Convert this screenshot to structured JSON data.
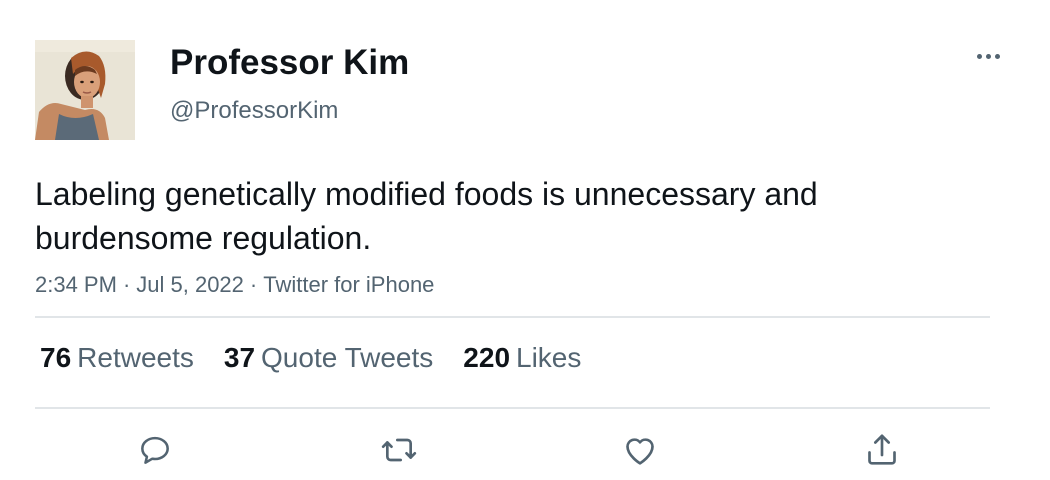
{
  "user": {
    "display_name": "Professor Kim",
    "handle": "@ProfessorKim",
    "avatar_icon": "profile-photo"
  },
  "menu": {
    "icon": "more-horizontal-icon"
  },
  "tweet": {
    "text": "Labeling genetically modified foods is unnecessary and burdensome regulation.",
    "time": "2:34 PM",
    "date": "Jul 5, 2022",
    "source": "Twitter for iPhone",
    "separator": "·"
  },
  "stats": [
    {
      "count": "76",
      "label": "Retweets"
    },
    {
      "count": "37",
      "label": "Quote Tweets"
    },
    {
      "count": "220",
      "label": "Likes"
    }
  ],
  "actions": [
    {
      "name": "reply",
      "icon": "reply-icon"
    },
    {
      "name": "retweet",
      "icon": "retweet-icon"
    },
    {
      "name": "like",
      "icon": "heart-icon"
    },
    {
      "name": "share",
      "icon": "share-icon"
    }
  ],
  "colors": {
    "text_primary": "#0f1419",
    "text_secondary": "#536471",
    "divider": "#e1e5e8",
    "icon": "#536471"
  }
}
